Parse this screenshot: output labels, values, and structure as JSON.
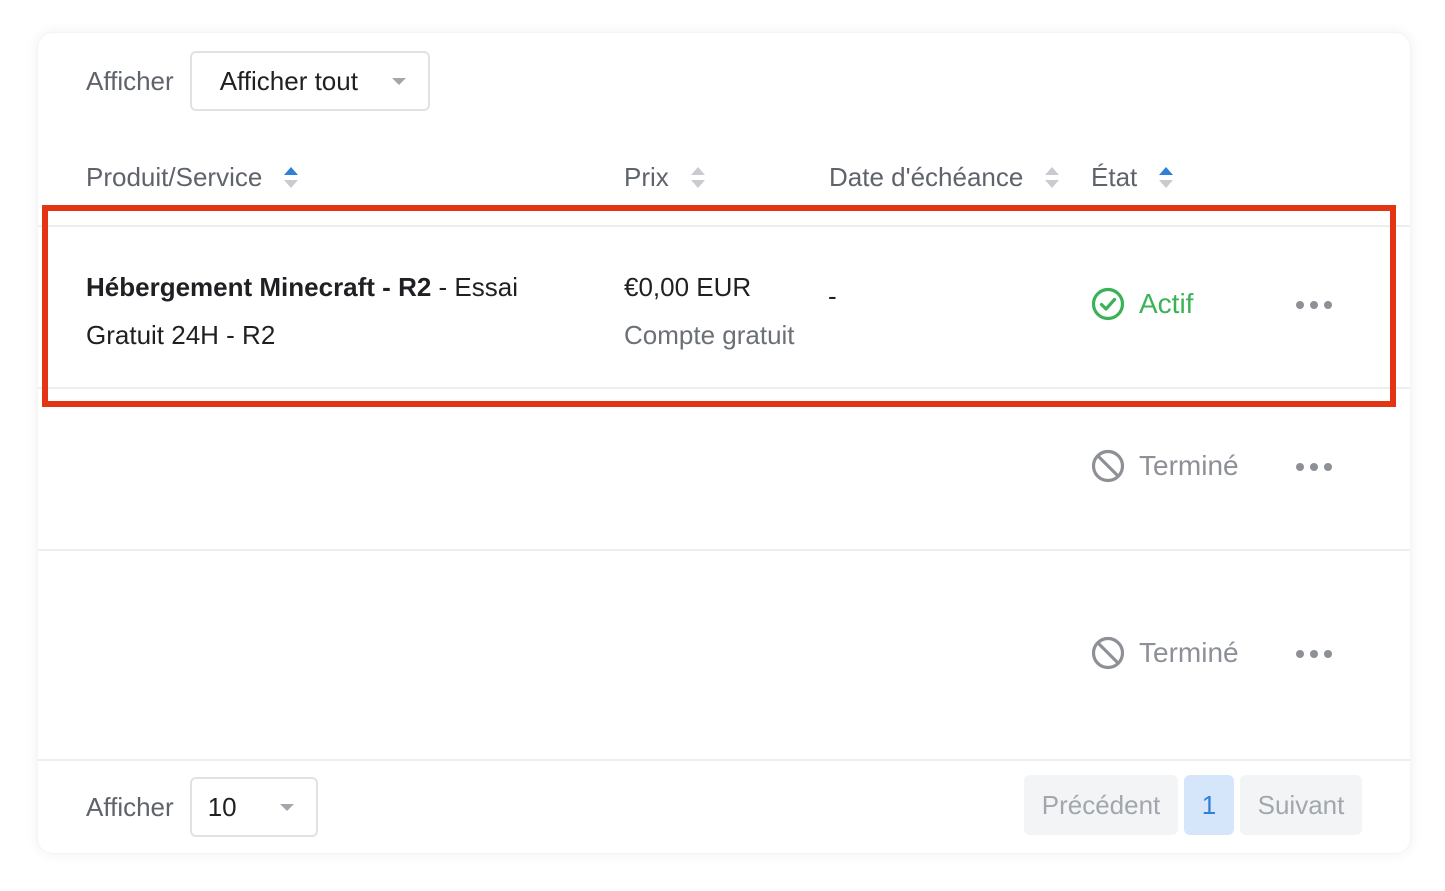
{
  "filter": {
    "label": "Afficher",
    "value": "Afficher tout"
  },
  "table": {
    "columns": [
      {
        "label": "Produit/Service"
      },
      {
        "label": "Prix"
      },
      {
        "label": "Date d'échéance"
      },
      {
        "label": "État"
      }
    ],
    "rows": [
      {
        "product_name": "Hébergement Minecraft - R2",
        "product_suffix": " - Essai Gratuit 24H - R2",
        "price": "€0,00 EUR",
        "billing": "Compte gratuit",
        "due": "-",
        "status": "Actif"
      },
      {
        "status": "Terminé"
      },
      {
        "status": "Terminé"
      }
    ]
  },
  "footer": {
    "label": "Afficher",
    "per_page": "10"
  },
  "pagination": {
    "prev": "Précédent",
    "current": "1",
    "next": "Suivant"
  },
  "colors": {
    "active": "#3cb257",
    "ended": "#8d9097",
    "accent": "#2f80d6",
    "highlight": "#e33513"
  },
  "icons": {
    "active": "check-circle-icon",
    "ended": "ban-icon",
    "menu": "more-horizontal-icon"
  }
}
